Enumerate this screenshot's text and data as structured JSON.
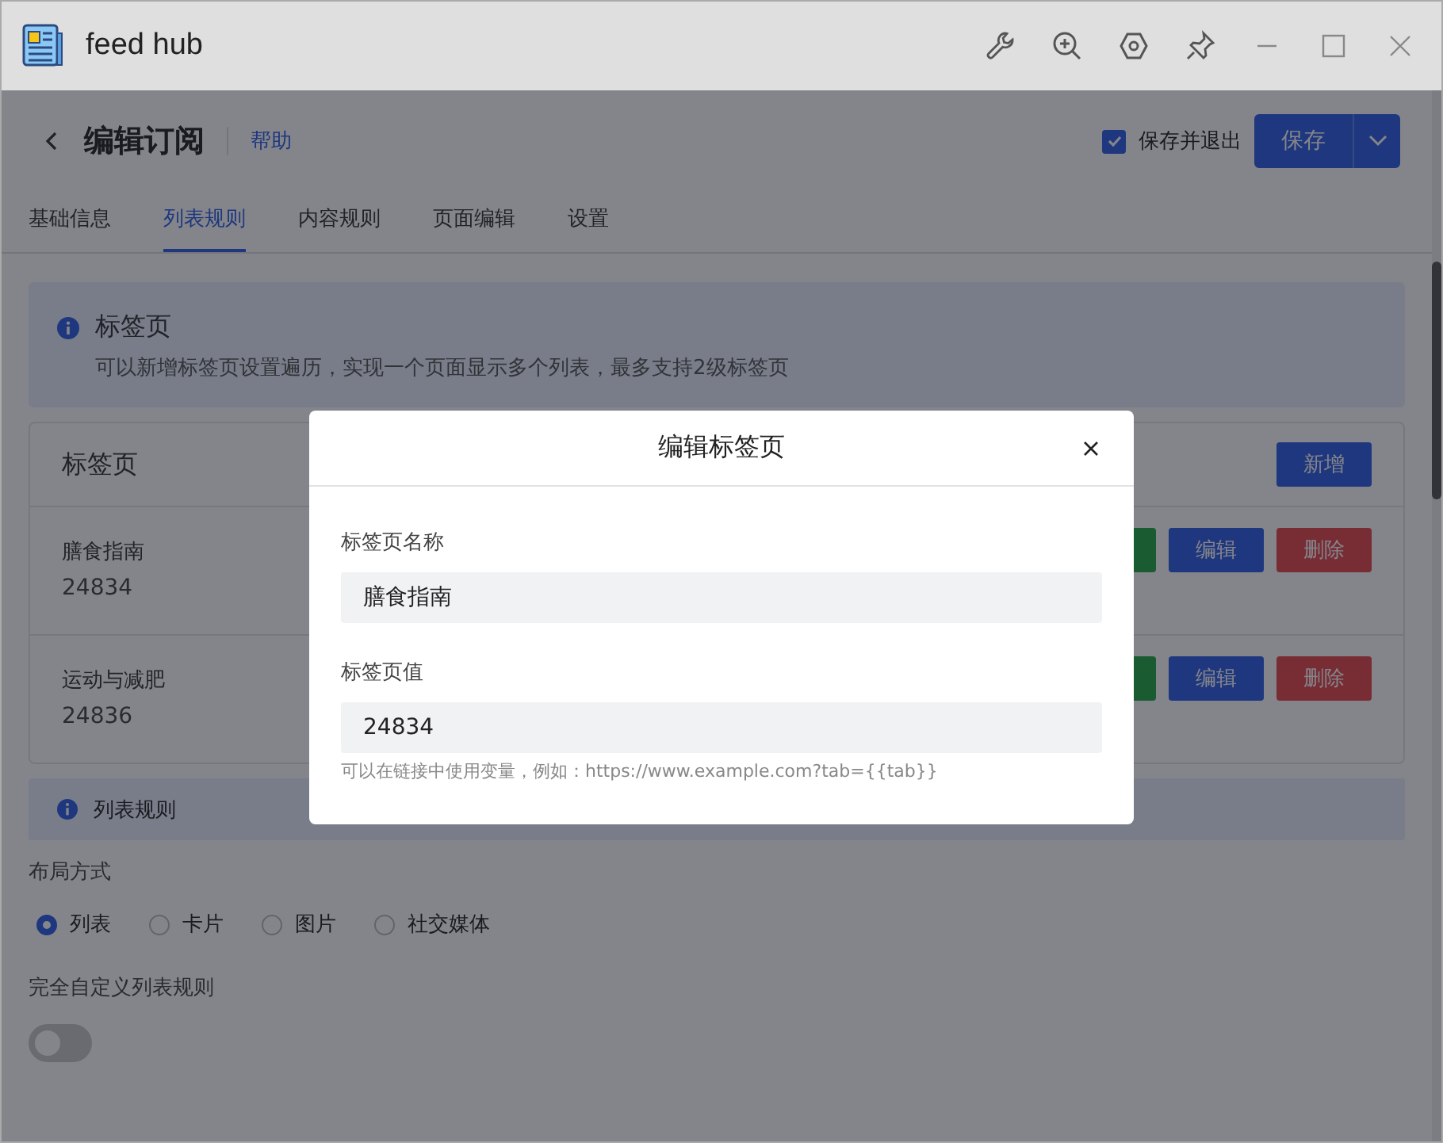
{
  "window": {
    "title": "feed hub"
  },
  "header": {
    "title": "编辑订阅",
    "help_link": "帮助",
    "save_and_exit": {
      "label": "保存并退出",
      "checked": true
    },
    "save_button": "保存"
  },
  "tabs": [
    {
      "label": "基础信息",
      "selected": false
    },
    {
      "label": "列表规则",
      "selected": true
    },
    {
      "label": "内容规则",
      "selected": false
    },
    {
      "label": "页面编辑",
      "selected": false
    },
    {
      "label": "设置",
      "selected": false
    }
  ],
  "tabs_notice": {
    "title": "标签页",
    "text": "可以新增标签页设置遍历，实现一个页面显示多个列表，最多支持2级标签页"
  },
  "tab_list": {
    "title": "标签页",
    "add_button": "新增",
    "rows": [
      {
        "name": "膳食指南",
        "value": "24834",
        "buttons": [
          {
            "kind": "success"
          },
          {
            "kind": "primary",
            "label": "编辑"
          },
          {
            "kind": "danger",
            "label": "删除"
          }
        ]
      },
      {
        "name": "运动与减肥",
        "value": "24836",
        "buttons": [
          {
            "kind": "success"
          },
          {
            "kind": "primary",
            "label": "编辑"
          },
          {
            "kind": "danger",
            "label": "删除"
          }
        ]
      }
    ]
  },
  "list_rules": {
    "title": "列表规则",
    "layout_label": "布局方式",
    "layouts": [
      {
        "label": "列表",
        "selected": true
      },
      {
        "label": "卡片",
        "selected": false
      },
      {
        "label": "图片",
        "selected": false
      },
      {
        "label": "社交媒体",
        "selected": false
      }
    ],
    "custom_label": "完全自定义列表规则",
    "custom_on": false
  },
  "dialog": {
    "title": "编辑标签页",
    "fields": [
      {
        "label": "标签页名称",
        "value": "膳食指南"
      },
      {
        "label": "标签页值",
        "value": "24834",
        "hint": "可以在链接中使用变量，例如：https://www.example.com?tab={{tab}}"
      }
    ]
  }
}
